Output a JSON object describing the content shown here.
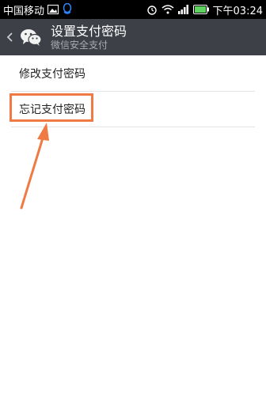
{
  "status_bar": {
    "carrier": "中国移动",
    "time": "下午03:24",
    "icons": [
      "image-icon",
      "qq-icon",
      "alarm-icon",
      "wifi-icon",
      "signal-icon",
      "battery-icon"
    ]
  },
  "header": {
    "title": "设置支付密码",
    "subtitle": "微信安全支付",
    "back_icon": "chevron-left-icon",
    "logo_icon": "wechat-icon",
    "background_color": "#3d4147"
  },
  "menu": {
    "items": [
      {
        "label": "修改支付密码"
      },
      {
        "label": "忘记支付密码"
      }
    ]
  },
  "annotation": {
    "highlight_color": "#f07a44"
  }
}
